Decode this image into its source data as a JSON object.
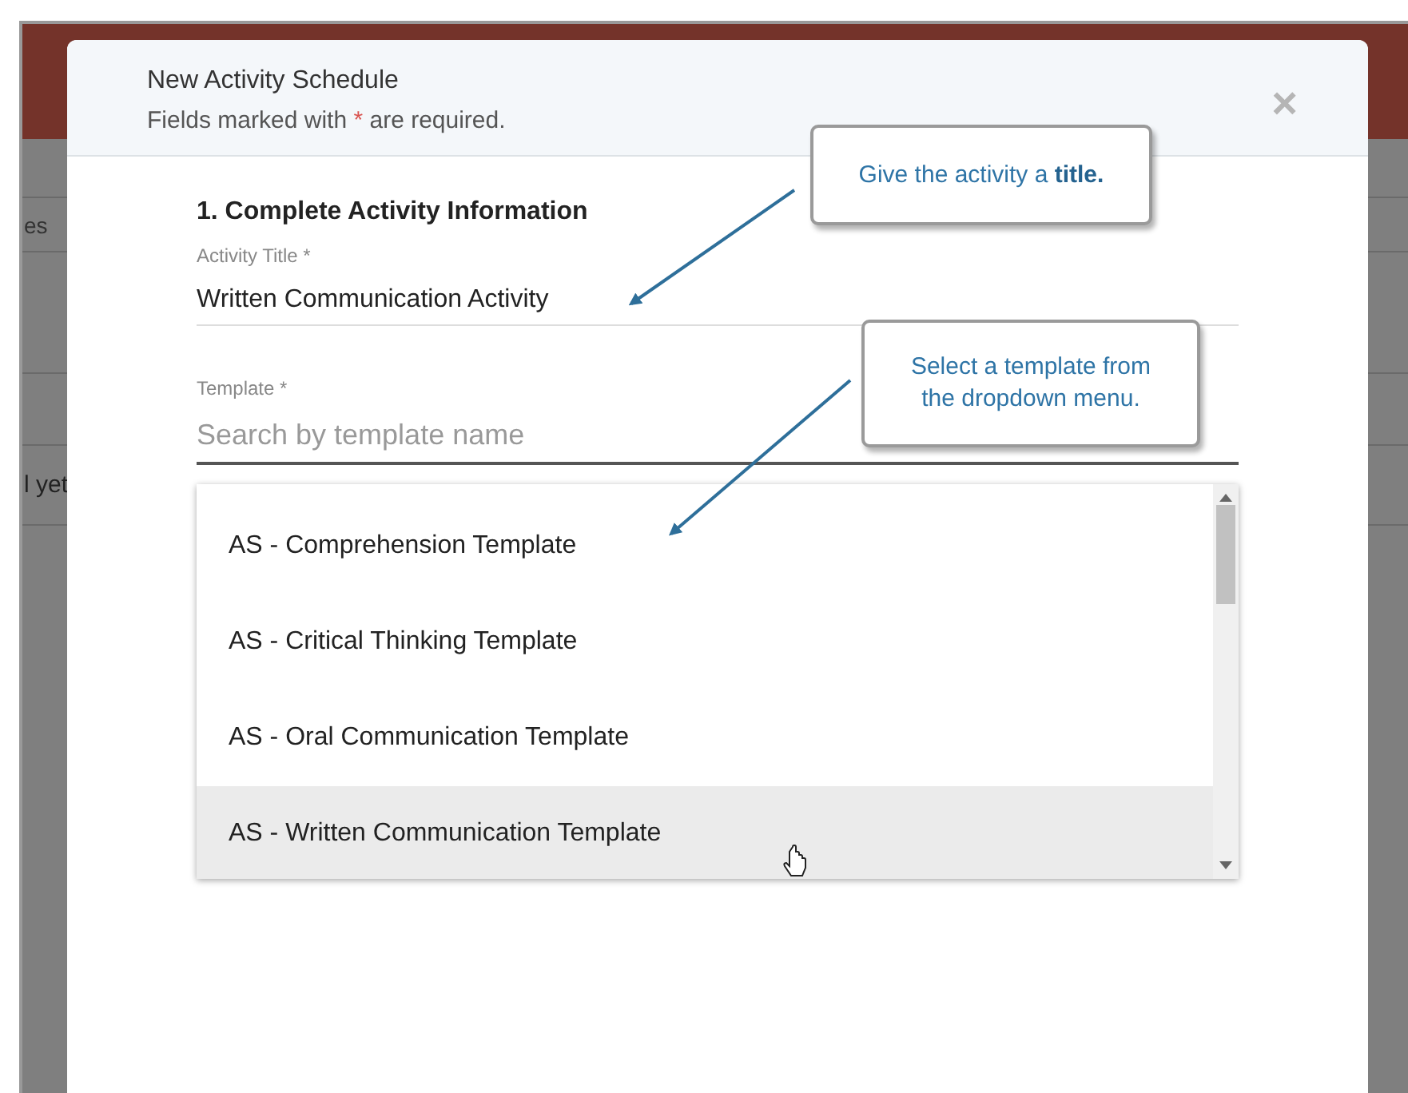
{
  "background": {
    "fragments": [
      "es",
      "l yet"
    ]
  },
  "dialog": {
    "title": "New Activity Schedule",
    "subtitle_before": "Fields marked with",
    "required_mark": "*",
    "subtitle_after": "are required.",
    "close": "×",
    "section": "1. Complete Activity Information",
    "fields": [
      {
        "label": "Activity Title *",
        "value": "Written Communication Activity"
      },
      {
        "label": "Template *",
        "placeholder": "Search by template name"
      }
    ],
    "options": [
      {
        "label": "AS - Comprehension Template",
        "highlighted": false
      },
      {
        "label": "AS - Critical Thinking Template",
        "highlighted": false
      },
      {
        "label": "AS - Oral Communication Template",
        "highlighted": false
      },
      {
        "label": "AS - Written Communication Template",
        "highlighted": true
      }
    ]
  },
  "callouts": [
    {
      "text": "Give the activity a **title.**"
    },
    {
      "text": "Select a template from the dropdown menu."
    }
  ]
}
